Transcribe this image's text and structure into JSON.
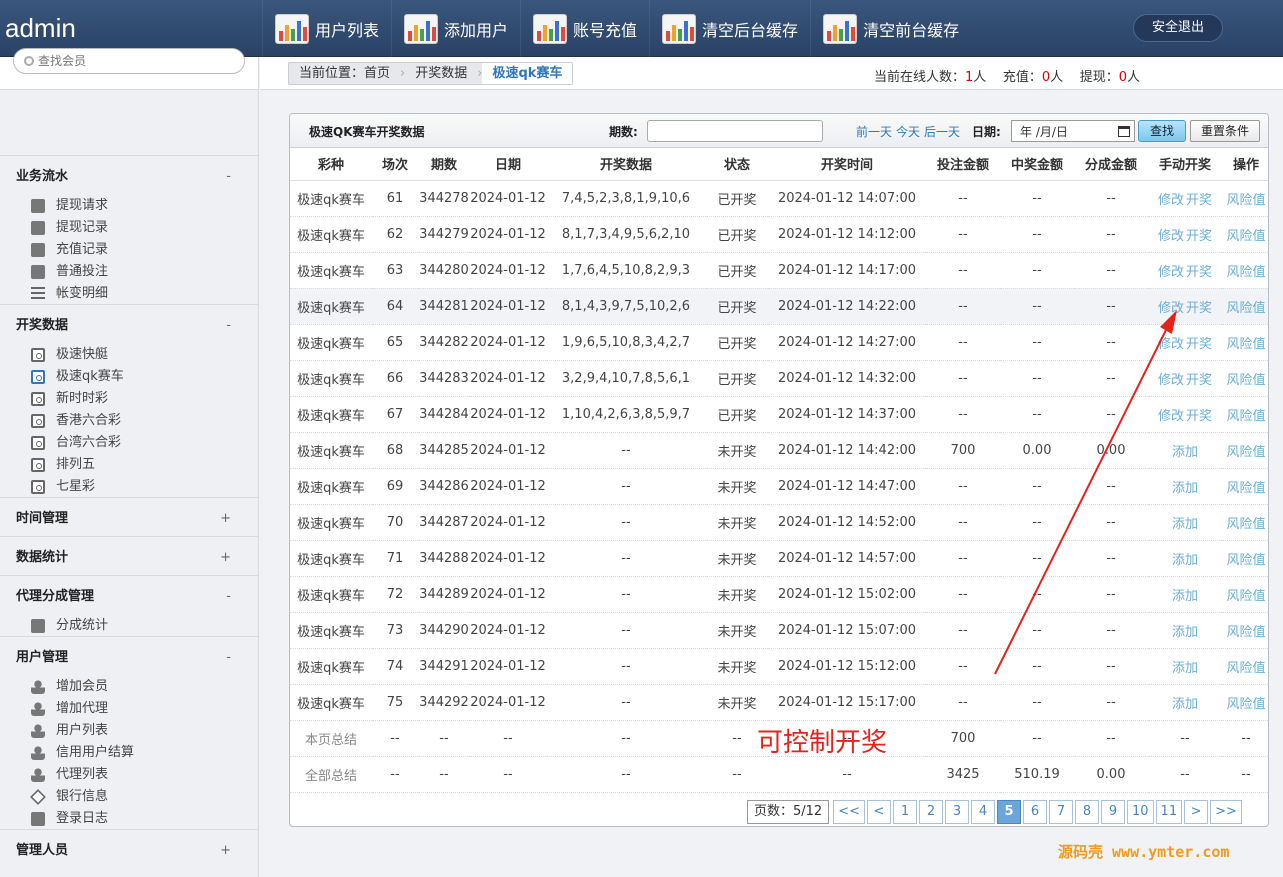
{
  "brand": "admin",
  "topnav": [
    {
      "label": "用户列表",
      "icon": "chart-icon"
    },
    {
      "label": "添加用户",
      "icon": "chart-icon"
    },
    {
      "label": "账号充值",
      "icon": "chart-icon"
    },
    {
      "label": "清空后台缓存",
      "icon": "chart-icon"
    },
    {
      "label": "清空前台缓存",
      "icon": "chart-icon"
    }
  ],
  "logout": "安全退出",
  "search_placeholder": "查找会员",
  "sidebar": [
    {
      "title": "业务流水",
      "toggle": "-",
      "items": [
        {
          "label": "提现请求",
          "icon": "speaker-icon"
        },
        {
          "label": "提现记录",
          "icon": "pen-icon"
        },
        {
          "label": "充值记录",
          "icon": "pen-icon"
        },
        {
          "label": "普通投注",
          "icon": "book-icon"
        },
        {
          "label": "帐变明细",
          "icon": "list-icon"
        }
      ]
    },
    {
      "title": "开奖数据",
      "toggle": "-",
      "items": [
        {
          "label": "极速快艇",
          "icon": "lottery-icon"
        },
        {
          "label": "极速qk赛车",
          "icon": "lottery-icon",
          "active": true
        },
        {
          "label": "新时时彩",
          "icon": "lottery-icon"
        },
        {
          "label": "香港六合彩",
          "icon": "lottery-icon"
        },
        {
          "label": "台湾六合彩",
          "icon": "lottery-icon"
        },
        {
          "label": "排列五",
          "icon": "lottery-icon"
        },
        {
          "label": "七星彩",
          "icon": "lottery-icon"
        }
      ]
    },
    {
      "title": "时间管理",
      "toggle": "+",
      "items": []
    },
    {
      "title": "数据统计",
      "toggle": "+",
      "items": []
    },
    {
      "title": "代理分成管理",
      "toggle": "-",
      "items": [
        {
          "label": "分成统计",
          "icon": "balloon-icon"
        }
      ]
    },
    {
      "title": "用户管理",
      "toggle": "-",
      "items": [
        {
          "label": "增加会员",
          "icon": "user-add-icon"
        },
        {
          "label": "增加代理",
          "icon": "user-add-icon"
        },
        {
          "label": "用户列表",
          "icon": "user-icon"
        },
        {
          "label": "信用用户结算",
          "icon": "user-icon"
        },
        {
          "label": "代理列表",
          "icon": "user-icon"
        },
        {
          "label": "银行信息",
          "icon": "diamond-icon"
        },
        {
          "label": "登录日志",
          "icon": "log-icon"
        }
      ]
    },
    {
      "title": "管理人员",
      "toggle": "+",
      "items": []
    }
  ],
  "breadcrumb": {
    "prefix": "当前位置：",
    "home": "首页",
    "section": "开奖数据",
    "current": "极速qk赛车"
  },
  "stats": {
    "online_label": "当前在线人数：",
    "online": "1",
    "recharge_label": "充值：",
    "recharge": "0",
    "withdraw_label": "提现：",
    "withdraw": "0",
    "unit": "人"
  },
  "toolbar": {
    "title": "极速QK赛车开奖数据",
    "period_label": "期数:",
    "prev_day": "前一天",
    "today": "今天",
    "next_day": "后一天",
    "date_label": "日期:",
    "date_placeholder": "年 /月/日",
    "find": "查找",
    "reset": "重置条件"
  },
  "columns": [
    "彩种",
    "场次",
    "期数",
    "日期",
    "开奖数据",
    "状态",
    "开奖时间",
    "投注金额",
    "中奖金额",
    "分成金额",
    "手动开奖",
    "操作"
  ],
  "rows": [
    {
      "game": "极速qk赛车",
      "round": "61",
      "period": "344278",
      "date": "2024-01-12",
      "draw": "7,4,5,2,3,8,1,9,10,6",
      "status": "已开奖",
      "time": "2024-01-12 14:07:00",
      "bet": "--",
      "win": "--",
      "share": "--",
      "actions": [
        "修改",
        "开奖"
      ],
      "op": "风险值"
    },
    {
      "game": "极速qk赛车",
      "round": "62",
      "period": "344279",
      "date": "2024-01-12",
      "draw": "8,1,7,3,4,9,5,6,2,10",
      "status": "已开奖",
      "time": "2024-01-12 14:12:00",
      "bet": "--",
      "win": "--",
      "share": "--",
      "actions": [
        "修改",
        "开奖"
      ],
      "op": "风险值"
    },
    {
      "game": "极速qk赛车",
      "round": "63",
      "period": "344280",
      "date": "2024-01-12",
      "draw": "1,7,6,4,5,10,8,2,9,3",
      "status": "已开奖",
      "time": "2024-01-12 14:17:00",
      "bet": "--",
      "win": "--",
      "share": "--",
      "actions": [
        "修改",
        "开奖"
      ],
      "op": "风险值"
    },
    {
      "game": "极速qk赛车",
      "round": "64",
      "period": "344281",
      "date": "2024-01-12",
      "draw": "8,1,4,3,9,7,5,10,2,6",
      "status": "已开奖",
      "time": "2024-01-12 14:22:00",
      "bet": "--",
      "win": "--",
      "share": "--",
      "actions": [
        "修改",
        "开奖"
      ],
      "op": "风险值",
      "hl": true
    },
    {
      "game": "极速qk赛车",
      "round": "65",
      "period": "344282",
      "date": "2024-01-12",
      "draw": "1,9,6,5,10,8,3,4,2,7",
      "status": "已开奖",
      "time": "2024-01-12 14:27:00",
      "bet": "--",
      "win": "--",
      "share": "--",
      "actions": [
        "修改",
        "开奖"
      ],
      "op": "风险值"
    },
    {
      "game": "极速qk赛车",
      "round": "66",
      "period": "344283",
      "date": "2024-01-12",
      "draw": "3,2,9,4,10,7,8,5,6,1",
      "status": "已开奖",
      "time": "2024-01-12 14:32:00",
      "bet": "--",
      "win": "--",
      "share": "--",
      "actions": [
        "修改",
        "开奖"
      ],
      "op": "风险值"
    },
    {
      "game": "极速qk赛车",
      "round": "67",
      "period": "344284",
      "date": "2024-01-12",
      "draw": "1,10,4,2,6,3,8,5,9,7",
      "status": "已开奖",
      "time": "2024-01-12 14:37:00",
      "bet": "--",
      "win": "--",
      "share": "--",
      "actions": [
        "修改",
        "开奖"
      ],
      "op": "风险值"
    },
    {
      "game": "极速qk赛车",
      "round": "68",
      "period": "344285",
      "date": "2024-01-12",
      "draw": "--",
      "status": "未开奖",
      "time": "2024-01-12 14:42:00",
      "bet": "700",
      "win": "0.00",
      "share": "0.00",
      "actions": [
        "添加"
      ],
      "op": "风险值"
    },
    {
      "game": "极速qk赛车",
      "round": "69",
      "period": "344286",
      "date": "2024-01-12",
      "draw": "--",
      "status": "未开奖",
      "time": "2024-01-12 14:47:00",
      "bet": "--",
      "win": "--",
      "share": "--",
      "actions": [
        "添加"
      ],
      "op": "风险值"
    },
    {
      "game": "极速qk赛车",
      "round": "70",
      "period": "344287",
      "date": "2024-01-12",
      "draw": "--",
      "status": "未开奖",
      "time": "2024-01-12 14:52:00",
      "bet": "--",
      "win": "--",
      "share": "--",
      "actions": [
        "添加"
      ],
      "op": "风险值"
    },
    {
      "game": "极速qk赛车",
      "round": "71",
      "period": "344288",
      "date": "2024-01-12",
      "draw": "--",
      "status": "未开奖",
      "time": "2024-01-12 14:57:00",
      "bet": "--",
      "win": "--",
      "share": "--",
      "actions": [
        "添加"
      ],
      "op": "风险值"
    },
    {
      "game": "极速qk赛车",
      "round": "72",
      "period": "344289",
      "date": "2024-01-12",
      "draw": "--",
      "status": "未开奖",
      "time": "2024-01-12 15:02:00",
      "bet": "--",
      "win": "--",
      "share": "--",
      "actions": [
        "添加"
      ],
      "op": "风险值"
    },
    {
      "game": "极速qk赛车",
      "round": "73",
      "period": "344290",
      "date": "2024-01-12",
      "draw": "--",
      "status": "未开奖",
      "time": "2024-01-12 15:07:00",
      "bet": "--",
      "win": "--",
      "share": "--",
      "actions": [
        "添加"
      ],
      "op": "风险值"
    },
    {
      "game": "极速qk赛车",
      "round": "74",
      "period": "344291",
      "date": "2024-01-12",
      "draw": "--",
      "status": "未开奖",
      "time": "2024-01-12 15:12:00",
      "bet": "--",
      "win": "--",
      "share": "--",
      "actions": [
        "添加"
      ],
      "op": "风险值"
    },
    {
      "game": "极速qk赛车",
      "round": "75",
      "period": "344292",
      "date": "2024-01-12",
      "draw": "--",
      "status": "未开奖",
      "time": "2024-01-12 15:17:00",
      "bet": "--",
      "win": "--",
      "share": "--",
      "actions": [
        "添加"
      ],
      "op": "风险值"
    }
  ],
  "totals": [
    {
      "label": "本页总结",
      "cells": [
        "--",
        "--",
        "--",
        "--",
        "--",
        "--",
        "700",
        "--",
        "--",
        "--",
        "--"
      ]
    },
    {
      "label": "全部总结",
      "cells": [
        "--",
        "--",
        "--",
        "--",
        "--",
        "--",
        "3425",
        "510.19",
        "0.00",
        "--",
        "--"
      ]
    }
  ],
  "pager": {
    "info": "页数：5/12",
    "first": "<<",
    "prev": "<",
    "pages": [
      "1",
      "2",
      "3",
      "4",
      "5",
      "6",
      "7",
      "8",
      "9",
      "10",
      "11"
    ],
    "current": "5",
    "next": ">",
    "last": ">>"
  },
  "annotation": "可控制开奖",
  "watermark": "源码壳 www.ymter.com",
  "colors": {
    "header": "#2f4a70",
    "link": "#6aaed6",
    "accent_red": "#e4231c",
    "active_page": "#6aa7d8"
  }
}
